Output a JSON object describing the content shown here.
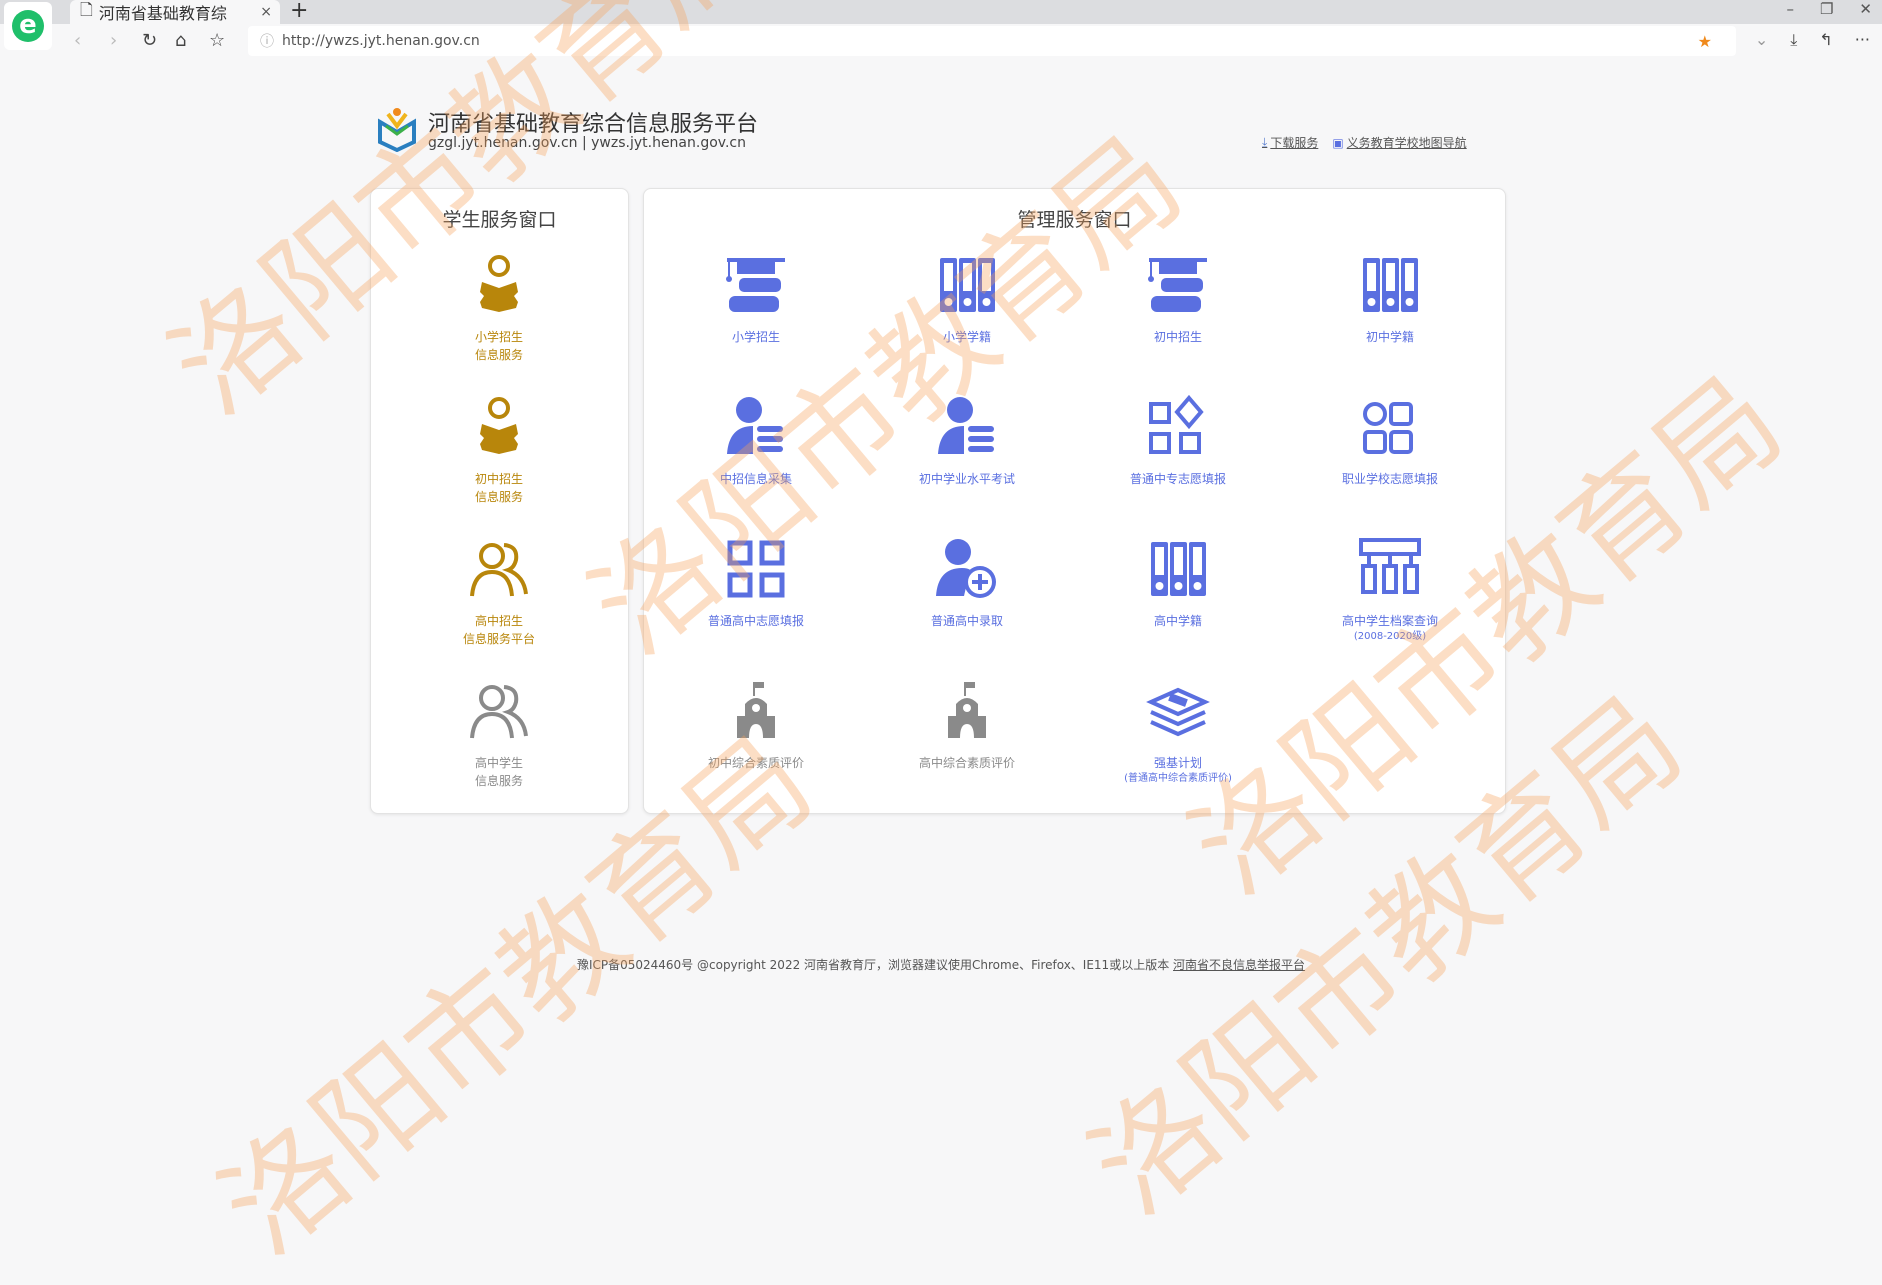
{
  "browser": {
    "tab_title": "河南省基础教育综",
    "url": "http://ywzs.jyt.henan.gov.cn",
    "new_tab": "+",
    "close_tab": "×",
    "win_min": "–",
    "win_max": "❐",
    "win_close": "✕"
  },
  "header": {
    "title": "河南省基础教育综合信息服务平台",
    "subtitle": "gzgl.jyt.henan.gov.cn | ywzs.jyt.henan.gov.cn",
    "links": [
      "下载服务",
      "义务教育学校地图导航"
    ]
  },
  "student_panel": {
    "title": "学生服务窗口",
    "items": [
      {
        "line1": "小学招生",
        "line2": "信息服务",
        "icon": "student-reading-icon"
      },
      {
        "line1": "初中招生",
        "line2": "信息服务",
        "icon": "student-reading-icon"
      },
      {
        "line1": "高中招生",
        "line2": "信息服务平台",
        "icon": "users-icon"
      },
      {
        "line1": "高中学生",
        "line2": "信息服务",
        "icon": "users-icon"
      }
    ]
  },
  "admin_panel": {
    "title": "管理服务窗口",
    "items": [
      {
        "label": "小学招生",
        "icon": "graduation-books-icon"
      },
      {
        "label": "小学学籍",
        "icon": "binders-icon"
      },
      {
        "label": "初中招生",
        "icon": "graduation-books-icon"
      },
      {
        "label": "初中学籍",
        "icon": "binders-icon"
      },
      {
        "label": "中招信息采集",
        "icon": "user-list-icon"
      },
      {
        "label": "初中学业水平考试",
        "icon": "user-list-icon"
      },
      {
        "label": "普通中专志愿填报",
        "icon": "apps-diamond-icon"
      },
      {
        "label": "职业学校志愿填报",
        "icon": "apps-circle-icon"
      },
      {
        "label": "普通高中志愿填报",
        "icon": "grid-icon"
      },
      {
        "label": "普通高中录取",
        "icon": "user-add-icon"
      },
      {
        "label": "高中学籍",
        "icon": "binders-icon"
      },
      {
        "label": "高中学生档案查询",
        "sub": "(2008-2020级)",
        "icon": "org-chart-icon"
      },
      {
        "label": "初中综合素质评价",
        "icon": "school-icon"
      },
      {
        "label": "高中综合素质评价",
        "icon": "school-icon"
      },
      {
        "label": "强基计划",
        "sub": "(普通高中综合素质评价)",
        "icon": "layers-icon"
      }
    ]
  },
  "footer": {
    "text": "豫ICP备05024460号 @copyright 2022 河南省教育厅，浏览器建议使用Chrome、Firefox、IE11或以上版本",
    "link": "河南省不良信息举报平台"
  },
  "watermark": "洛阳市教育局",
  "colors": {
    "blue": "#5a6fe0",
    "gold": "#b8860b",
    "gray": "#8a8a8a",
    "watermark": "#f5a05a"
  }
}
